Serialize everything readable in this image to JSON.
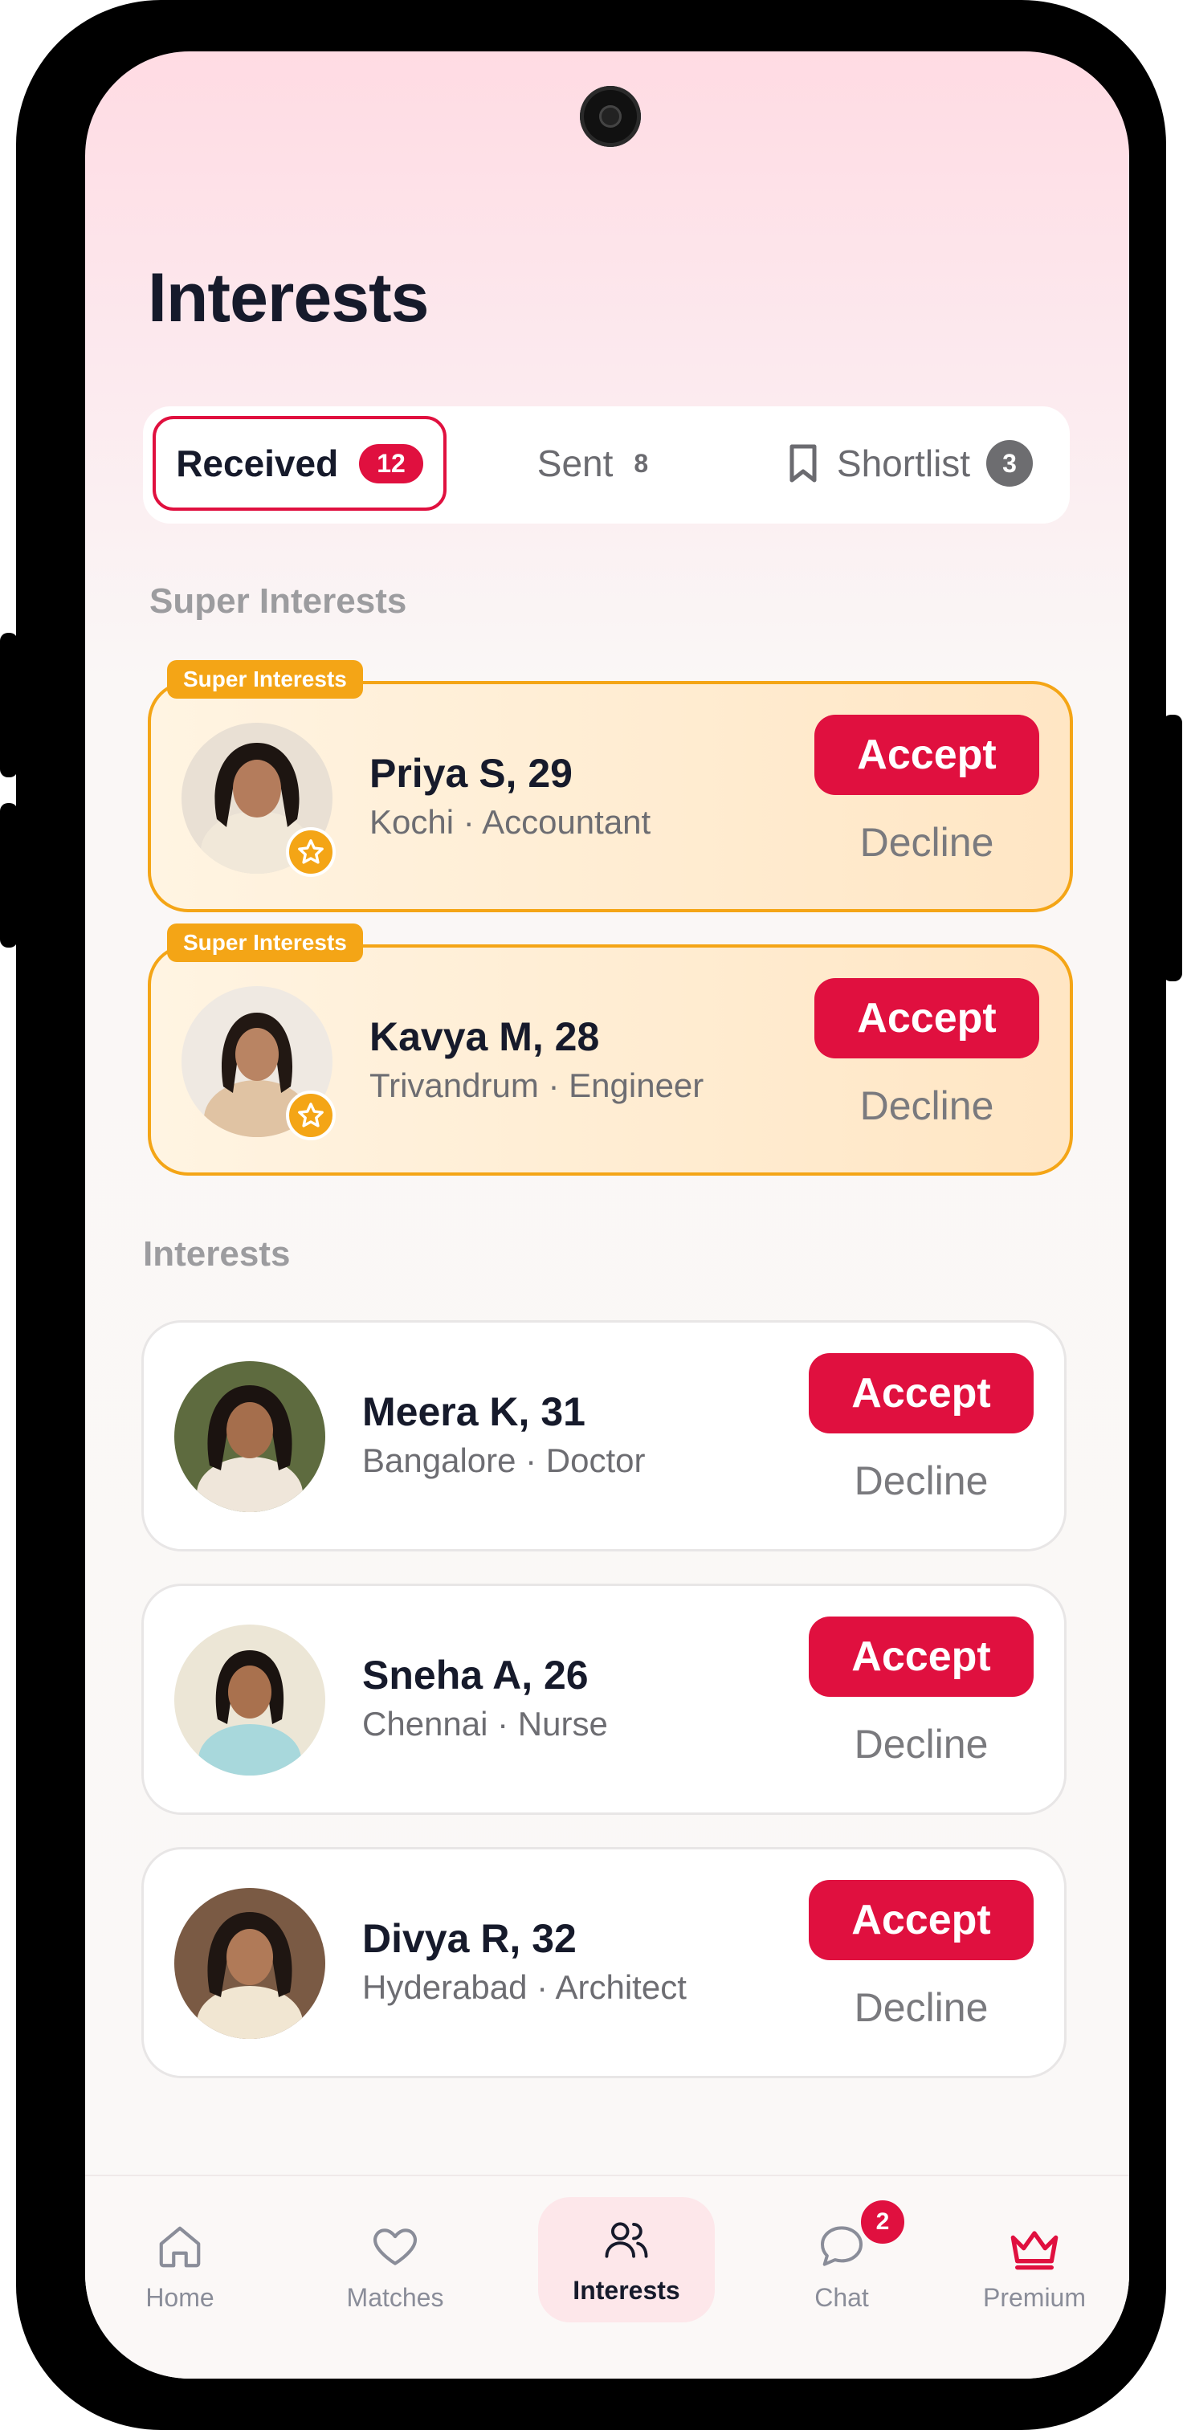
{
  "header": {
    "title": "Interests"
  },
  "tabs": [
    {
      "label": "Received",
      "count": "12"
    },
    {
      "label": "Sent",
      "count": "8"
    },
    {
      "label": "Shortlist",
      "count": "3"
    }
  ],
  "sections": {
    "super": "Super Interests",
    "regular": "Interests"
  },
  "super_tag": "Super Interests",
  "super_cards": [
    {
      "name": "Priya S, 29",
      "meta": "Kochi · Accountant",
      "accept": "Accept",
      "decline": "Decline"
    },
    {
      "name": "Kavya M, 28",
      "meta": "Trivandrum · Engineer",
      "accept": "Accept",
      "decline": "Decline"
    }
  ],
  "cards": [
    {
      "name": "Meera K, 31",
      "meta": "Bangalore · Doctor",
      "accept": "Accept",
      "decline": "Decline"
    },
    {
      "name": "Sneha A, 26",
      "meta": "Chennai · Nurse",
      "accept": "Accept",
      "decline": "Decline"
    },
    {
      "name": "Divya R, 32",
      "meta": "Hyderabad · Architect",
      "accept": "Accept",
      "decline": "Decline"
    }
  ],
  "nav": [
    {
      "label": "Home",
      "icon": "home-icon"
    },
    {
      "label": "Matches",
      "icon": "heart-icon"
    },
    {
      "label": "Interests",
      "icon": "users-icon"
    },
    {
      "label": "Chat",
      "icon": "chat-icon",
      "badge": "2"
    },
    {
      "label": "Premium",
      "icon": "crown-icon"
    }
  ],
  "colors": {
    "accent": "#e0103f",
    "super": "#f4a516"
  }
}
